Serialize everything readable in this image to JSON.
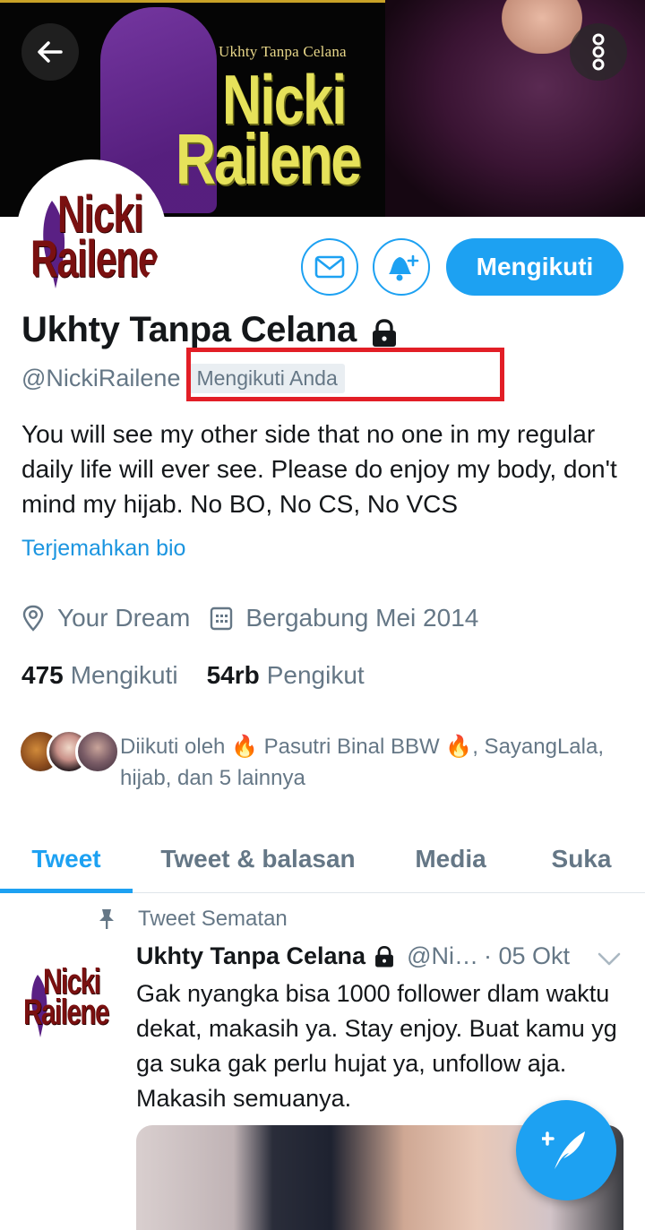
{
  "banner": {
    "subtitle": "Ukhty Tanpa Celana",
    "title_line1": "Nicki",
    "title_line2": "Railene"
  },
  "header": {
    "back_icon": "arrow-left-icon",
    "more_icon": "more-vertical-icon"
  },
  "avatar": {
    "logo_line1": "Nicki",
    "logo_line2": "Railene"
  },
  "actions": {
    "message_icon": "envelope-icon",
    "notify_icon": "bell-plus-icon",
    "follow_label": "Mengikuti"
  },
  "profile": {
    "display_name": "Ukhty Tanpa Celana",
    "handle": "@NickiRailene",
    "follows_you": "Mengikuti Anda",
    "bio": "You will see my other side that no one in my regular daily life will ever see. Please do enjoy my body, don't mind my hijab. No BO, No CS, No VCS",
    "translate_bio": "Terjemahkan bio",
    "location": "Your Dream",
    "joined": "Bergabung Mei 2014",
    "following_count": "475",
    "following_label": "Mengikuti",
    "followers_count": "54rb",
    "followers_label": "Pengikut",
    "followed_by_text": "Diikuti oleh 🔥 Pasutri Binal BBW 🔥, SayangLala, hijab, dan 5 lainnya"
  },
  "tabs": [
    {
      "label": "Tweet",
      "active": true
    },
    {
      "label": "Tweet & balasan",
      "active": false
    },
    {
      "label": "Media",
      "active": false
    },
    {
      "label": "Suka",
      "active": false
    }
  ],
  "pinned_tweet": {
    "pinned_label": "Tweet Sematan",
    "name": "Ukhty Tanpa Celana",
    "handle": "@Ni…",
    "date": "· 05 Okt",
    "text": "Gak nyangka bisa 1000 follower dlam waktu dekat, makasih ya. Stay enjoy. Buat kamu yg ga suka gak perlu hujat ya, unfollow aja. Makasih semuanya."
  },
  "fab": {
    "icon": "compose-tweet-icon"
  },
  "colors": {
    "accent": "#1da1f2",
    "secondary_text": "#657786",
    "highlight": "#e21e26"
  }
}
